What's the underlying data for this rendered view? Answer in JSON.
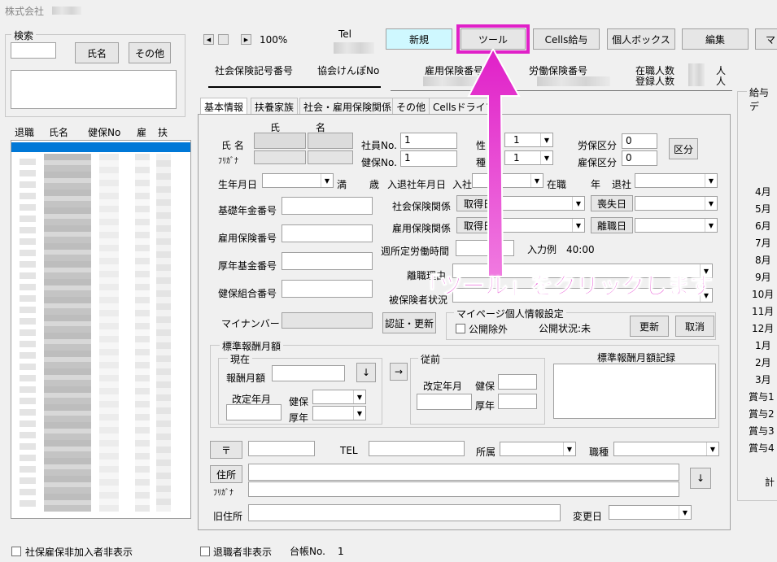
{
  "window_title": "株式会社",
  "search": {
    "title": "検索",
    "name_button": "氏名",
    "other_button": "その他",
    "list_headers": [
      "退職",
      "氏名",
      "健保No",
      "雇",
      "扶"
    ]
  },
  "toolbar": {
    "zoom": "100%",
    "tel_label": "Tel",
    "new_button": "新規",
    "tool_button": "ツール",
    "cells_button": "Cells給与",
    "personal_box_button": "個人ボックス",
    "edit_button": "編集",
    "extra_button": "マ"
  },
  "header_labels": {
    "shaho_no": "社会保険記号番号",
    "kyokai_no": "協会けんぽNo",
    "koyo_no": "雇用保険番号",
    "rodo_no": "労働保険番号",
    "zaishoku": "在職人数",
    "toroku": "登録人数",
    "nin1": "人",
    "nin2": "人"
  },
  "tabs": [
    "基本情報",
    "扶養家族",
    "社会・雇用保険関係",
    "その他",
    "Cellsドライブ"
  ],
  "form": {
    "shi": "氏",
    "mei": "名",
    "name_label": "氏 名",
    "furigana_label": "ﾌﾘｶﾞﾅ",
    "employee_no_label": "社員No.",
    "employee_no": "1",
    "kenpo_no_label": "健保No.",
    "kenpo_no": "1",
    "gender_label": "性",
    "gender_value": "1",
    "type_label": "種",
    "type_value": "1",
    "rodo_kubun_label": "労保区分",
    "rodo_kubun": "0",
    "koyo_kubun_label": "雇保区分",
    "koyo_kubun": "0",
    "kubun_button": "区分",
    "birthday_label": "生年月日",
    "man_label": "満",
    "sai_label": "歳",
    "nyutai_label": "入退社年月日",
    "nyusha_label": "入社",
    "zaishoku_label": "在職",
    "nen_label": "年",
    "taisha_label": "退社",
    "kiso_label": "基礎年金番号",
    "shaho_kankei_label": "社会保険関係",
    "shutoku_button": "取得日",
    "soshitsu_button": "喪失日",
    "koyo_bango_label": "雇用保険番号",
    "koyo_kankei_label": "雇用保険関係",
    "shutoku_button2": "取得日",
    "rishoku_button": "離職日",
    "weekly_hours_label": "週所定労働時間",
    "input_example": "入力例　40:00",
    "kosei_label": "厚年基金番号",
    "riri_label": "離職理由",
    "kenpo_kumiai_label": "健保組合番号",
    "hihokensha_label": "被保険者状況",
    "mynumber_label": "マイナンバー",
    "auth_button": "認証・更新",
    "mypage_title": "マイページ個人情報設定",
    "kokai_jogai": "公開除外",
    "kokai_status": "公開状況:未",
    "update_button": "更新",
    "cancel_button": "取消"
  },
  "standard_pay": {
    "title": "標準報酬月額",
    "current_title": "現在",
    "monthly_label": "報酬月額",
    "down_arrow": "↓",
    "right_arrow": "→",
    "revision_label": "改定年月",
    "kenpo_label": "健保",
    "kosei_label": "厚年",
    "previous_title": "従前",
    "prev_revision_label": "改定年月",
    "prev_kenpo_label": "健保",
    "prev_kosei_label": "厚年",
    "record_title": "標準報酬月額記録"
  },
  "address": {
    "postal_button": "〒",
    "tel_label": "TEL",
    "shozoku_label": "所属",
    "shokushu_label": "職種",
    "address_button": "住所",
    "furigana_label": "ﾌﾘｶﾞﾅ",
    "down_arrow": "↓",
    "old_address_label": "旧住所",
    "change_date_label": "変更日"
  },
  "salary_panel": {
    "title": "給与デ",
    "months": [
      "4月",
      "5月",
      "6月",
      "7月",
      "8月",
      "9月",
      "10月",
      "11月",
      "12月",
      "1月",
      "2月",
      "3月",
      "賞与1",
      "賞与2",
      "賞与3",
      "賞与4"
    ],
    "total": "計"
  },
  "footer": {
    "hide_unjoined": "社保雇保非加入者非表示",
    "hide_retired": "退職者非表示",
    "ledger_label": "台帳No.",
    "ledger_no": "1"
  },
  "annotation": {
    "callout": "「ツール」をクリックします",
    "highlight_color": "#e020c8"
  }
}
